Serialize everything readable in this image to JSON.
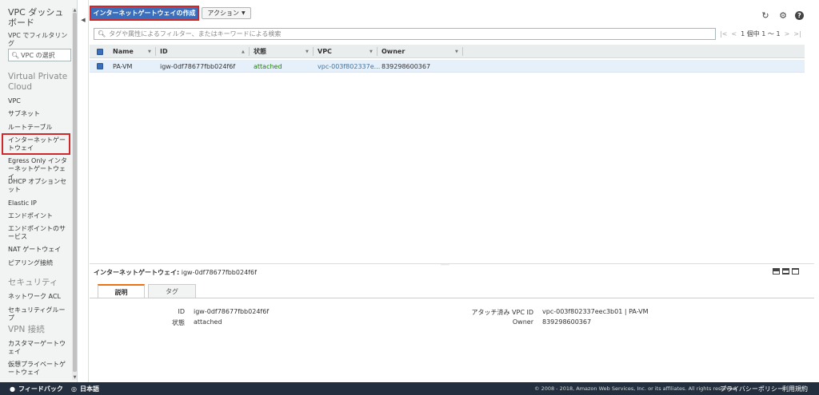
{
  "sidebar": {
    "title": "VPC ダッシュボード",
    "filter_label": "VPC でフィルタリング",
    "filter_select": "VPC の選択",
    "sections": {
      "vpc": "Virtual Private Cloud",
      "security": "セキュリティ",
      "vpn": "VPN 接続"
    },
    "items": {
      "vpc": "VPC",
      "subnet": "サブネット",
      "route_table": "ルートテーブル",
      "igw": "インターネットゲートウェイ",
      "egress": "Egress Only インターネットゲートウェイ",
      "dhcp": "DHCP オプションセット",
      "eip": "Elastic IP",
      "endpoint": "エンドポイント",
      "endpoint_service": "エンドポイントのサービス",
      "nat": "NAT ゲートウェイ",
      "peering": "ピアリング接続",
      "nacl": "ネットワーク ACL",
      "sg": "セキュリティグループ",
      "cgw": "カスタマーゲートウェイ",
      "vgw": "仮想プライベートゲートウェイ"
    }
  },
  "toolbar": {
    "create_label": "インターネットゲートウェイの作成",
    "action_label": "アクション"
  },
  "search": {
    "placeholder": "タグや属性によるフィルター、またはキーワードによる検索"
  },
  "pager": {
    "text": "1 個中 1 ～ 1"
  },
  "table": {
    "headers": [
      "Name",
      "ID",
      "状態",
      "VPC",
      "Owner"
    ],
    "rows": [
      {
        "name": "PA-VM",
        "id": "igw-0df78677fbb024f6f",
        "state": "attached",
        "vpc": "vpc-003f802337e...",
        "owner": "839298600367"
      }
    ]
  },
  "detail": {
    "title_label": "インターネットゲートウェイ:",
    "title_value": "igw-0df78677fbb024f6f",
    "tabs": [
      "説明",
      "タグ"
    ],
    "fields": {
      "id_label": "ID",
      "id_value": "igw-0df78677fbb024f6f",
      "state_label": "状態",
      "state_value": "attached",
      "vpc_label": "アタッチ済み VPC ID",
      "vpc_value": "vpc-003f802337eec3b01 | PA-VM",
      "owner_label": "Owner",
      "owner_value": "839298600367"
    }
  },
  "footer": {
    "feedback": "フィードバック",
    "language": "日本語",
    "copyright": "© 2008 - 2018, Amazon Web Services, Inc. or its affiliates. All rights reserved.",
    "privacy": "プライバシーポリシー",
    "terms": "利用規約"
  },
  "icons": {
    "refresh": "refresh-icon",
    "settings": "gear-icon",
    "help": "help-icon",
    "search": "search-icon"
  },
  "colors": {
    "primary": "#3b6fbb",
    "highlight": "#d0272a",
    "attached": "#1d8102",
    "footer": "#232f3e"
  }
}
